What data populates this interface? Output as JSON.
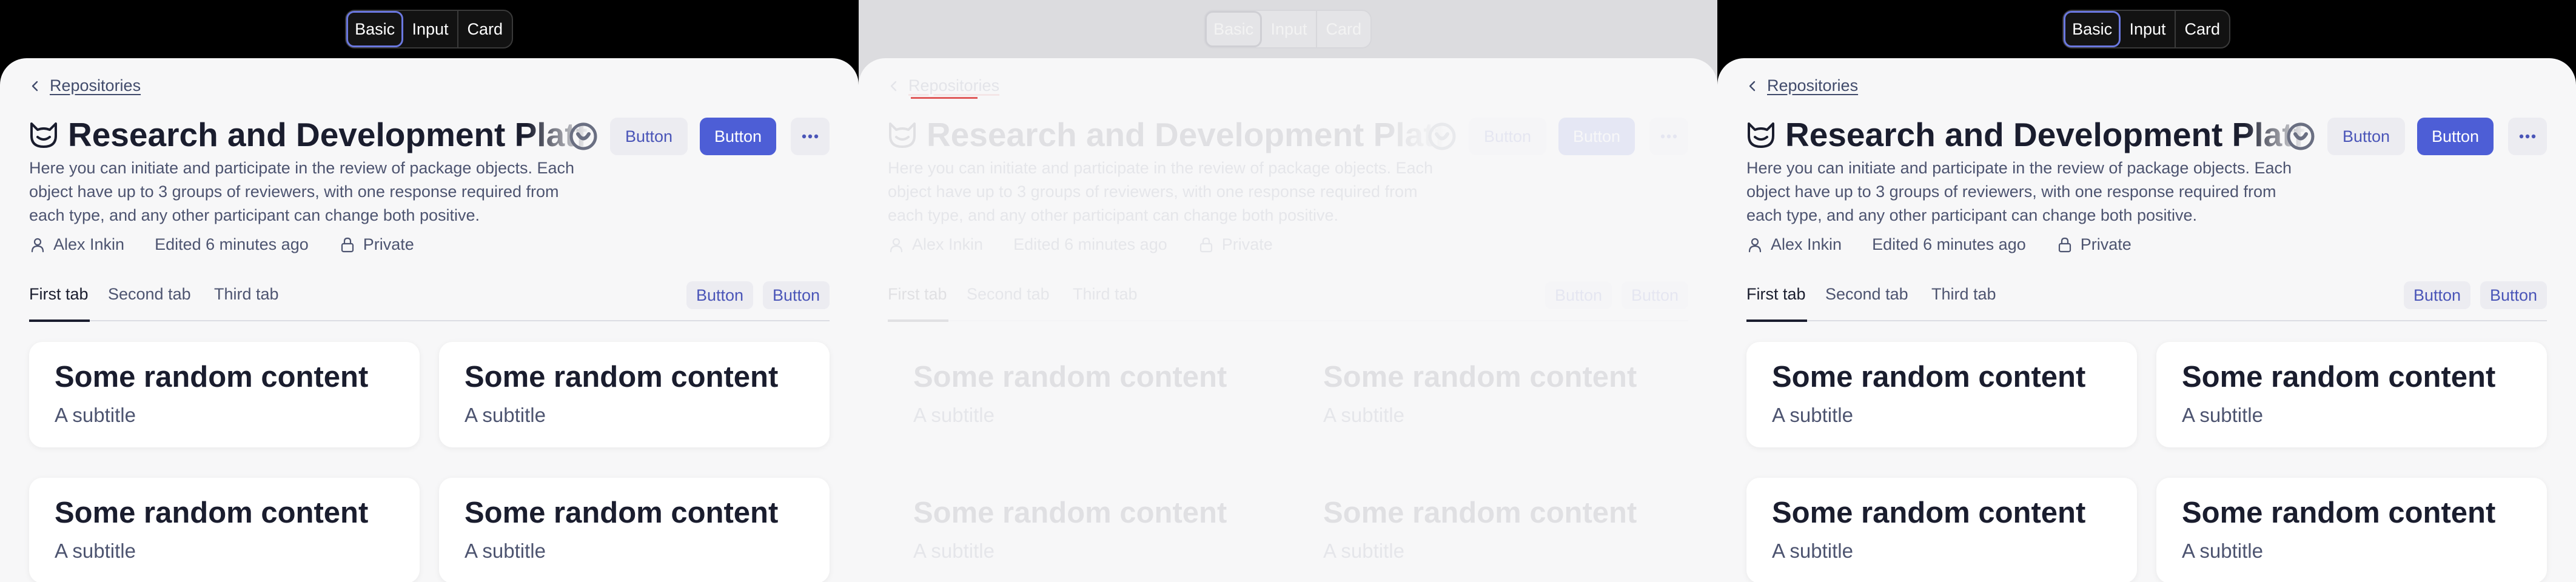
{
  "segment": {
    "items": [
      "Basic",
      "Input",
      "Card"
    ],
    "active": "Basic"
  },
  "back": {
    "label": "Repositories"
  },
  "header": {
    "title": "Research and Development Platform",
    "secondary_button": "Button",
    "primary_button": "Button"
  },
  "description": "Here you can initiate and participate in the review of package objects. Each object have up to 3 groups of reviewers, with one response required from each type, and any other participant can change both positive.",
  "meta": {
    "author": "Alex Inkin",
    "edited": "Edited 6 minutes ago",
    "visibility": "Private"
  },
  "tabs": {
    "items": [
      "First tab",
      "Second tab",
      "Third tab"
    ],
    "active": "First tab",
    "buttons": [
      "Button",
      "Button"
    ]
  },
  "cards": [
    {
      "title": "Some random content",
      "subtitle": "A subtitle"
    },
    {
      "title": "Some random content",
      "subtitle": "A subtitle"
    },
    {
      "title": "Some random content",
      "subtitle": "A subtitle"
    },
    {
      "title": "Some random content",
      "subtitle": "A subtitle"
    }
  ],
  "colors": {
    "accent": "#4d5ed6",
    "text_primary": "#1a1d2e",
    "text_secondary": "#4d5470",
    "sheet_bg": "#f7f7f8",
    "loading_overlay": "#dcdcdf"
  },
  "icons": {
    "back": "chevron-left-icon",
    "logo": "cat-logo-icon",
    "verified": "verified-badge-icon",
    "more": "ellipsis-icon",
    "author": "user-icon",
    "visibility": "lock-icon"
  }
}
